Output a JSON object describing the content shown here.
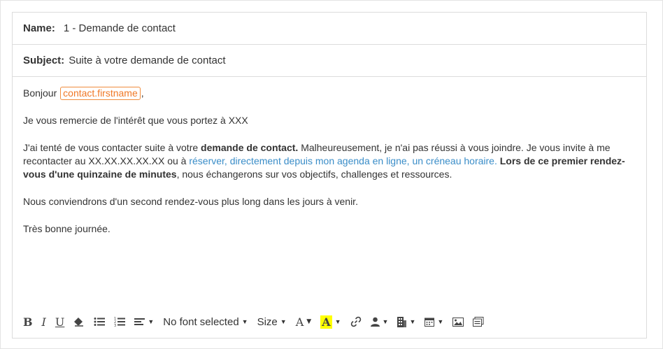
{
  "fields": {
    "name_label": "Name:",
    "name_value": "1 - Demande de contact",
    "subject_label": "Subject:",
    "subject_value": "Suite à votre demande de contact"
  },
  "message": {
    "greeting": "Bonjour",
    "variable": "contact.firstname",
    "greeting_end": ",",
    "p1": "Je vous remercie de l'intérêt que vous portez à XXX",
    "p2_a": "J'ai tenté de vous contacter suite à votre ",
    "p2_b": "demande de contact.",
    "p2_c": " Malheureusement, je n'ai pas réussi à vous joindre. Je vous invite à me recontacter au XX.XX.XX.XX.XX ou à ",
    "p2_link": "réserver, directement depuis mon agenda en ligne, un créneau horaire.",
    "p2_d": " ",
    "p2_e": "Lors de ce premier rendez-vous d'une quinzaine de minutes",
    "p2_f": ", nous échangerons sur vos objectifs, challenges et ressources.",
    "p3": "Nous conviendrons d'un second rendez-vous plus long dans les jours à venir.",
    "p4": "Très bonne journée."
  },
  "toolbar": {
    "bold": "B",
    "italic": "I",
    "underline": "U",
    "font": "No font selected",
    "size": "Size",
    "font_color": "A",
    "highlight": "A"
  },
  "icons": {
    "eraser": "eraser-icon",
    "bullets": "unordered-list-icon",
    "numbers": "ordered-list-icon",
    "align": "align-left-icon",
    "link": "link-icon",
    "personalize": "user-icon",
    "company": "building-icon",
    "calendar": "calendar-icon",
    "image": "image-icon",
    "snippet": "snippet-icon"
  },
  "colors": {
    "variable": "#f07826",
    "link": "#3a8dc8",
    "highlight": "#ffff00"
  }
}
